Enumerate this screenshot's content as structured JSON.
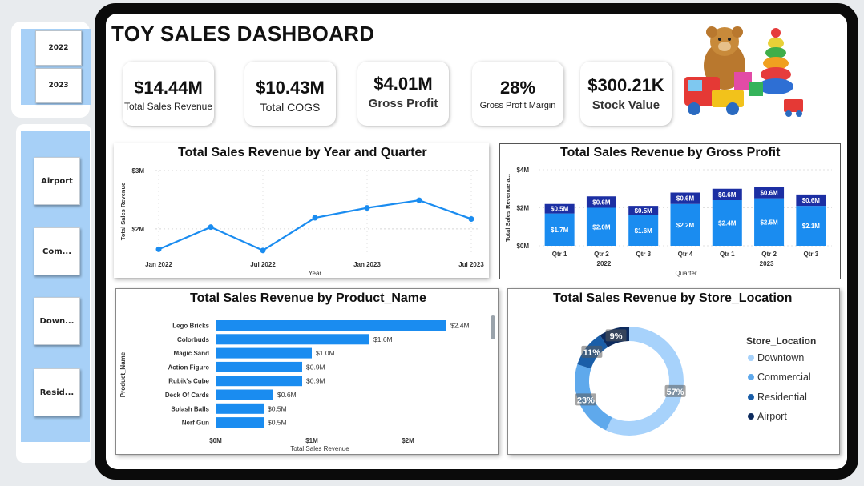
{
  "dashboard_title": "TOY SALES DASHBOARD",
  "year_slicer": [
    "2022",
    "2023"
  ],
  "location_slicer": [
    "Airport",
    "Com...",
    "Down...",
    "Resid..."
  ],
  "kpis": [
    {
      "value": "$14.44M",
      "label": "Total Sales Revenue"
    },
    {
      "value": "$10.43M",
      "label": "Total COGS"
    },
    {
      "value": "$4.01M",
      "label": "Gross Profit"
    },
    {
      "value": "28%",
      "label": "Gross Profit Margin"
    },
    {
      "value": "$300.21K",
      "label": "Stock Value"
    }
  ],
  "colors": {
    "line": "#1a8cf0",
    "bar_dark": "#1c2fa3",
    "bar_light": "#1a8cf0",
    "downtown": "#a7d2fb",
    "commercial": "#5fa9ec",
    "residential": "#1a5ea8",
    "airport": "#0d2b5e"
  },
  "chart_data": [
    {
      "type": "line",
      "title": "Total Sales Revenue by Year and Quarter",
      "xlabel": "Year",
      "ylabel": "Total Sales Revenue",
      "x_tick_labels": [
        "Jan 2022",
        "Jul 2022",
        "Jan 2023",
        "Jul 2023"
      ],
      "y_tick_labels": [
        "$3M",
        "$2M"
      ],
      "ylim": [
        1.6,
        3.0
      ],
      "grid": true,
      "x": [
        "2022 Q1",
        "2022 Q2",
        "2022 Q3",
        "2022 Q4",
        "2023 Q1",
        "2023 Q2",
        "2023 Q3"
      ],
      "series": [
        {
          "values": [
            1.65,
            2.03,
            1.63,
            2.19,
            2.36,
            2.49,
            2.17
          ]
        }
      ]
    },
    {
      "type": "bar",
      "stacked": true,
      "title": "Total Sales Revenue by Gross Profit",
      "xlabel": "Quarter",
      "ylabel": "Total Sales Revenue a...",
      "categories": [
        "Qtr 1",
        "Qtr 2",
        "Qtr 3",
        "Qtr 4",
        "Qtr 1",
        "Qtr 2",
        "Qtr 3"
      ],
      "year_groups": [
        "2022",
        "2023"
      ],
      "y_tick_labels": [
        "$4M",
        "$2M",
        "$0M"
      ],
      "ylim": [
        0,
        4
      ],
      "series": [
        {
          "values": [
            1.7,
            2.0,
            1.6,
            2.2,
            2.4,
            2.5,
            2.1
          ],
          "labels": [
            "$1.7M",
            "$2.0M",
            "$1.6M",
            "$2.2M",
            "$2.4M",
            "$2.5M",
            "$2.1M"
          ]
        },
        {
          "values": [
            0.5,
            0.6,
            0.5,
            0.6,
            0.6,
            0.6,
            0.6
          ],
          "labels": [
            "$0.5M",
            "$0.6M",
            "$0.5M",
            "$0.6M",
            "$0.6M",
            "$0.6M",
            "$0.6M"
          ]
        }
      ]
    },
    {
      "type": "bar",
      "orientation": "horizontal",
      "title": "Total Sales Revenue by Product_Name",
      "xlabel": "Total Sales Revenue",
      "ylabel": "Product_Name",
      "categories": [
        "Lego Bricks",
        "Colorbuds",
        "Magic Sand",
        "Action Figure",
        "Rubik's Cube",
        "Deck Of Cards",
        "Splash Balls",
        "Nerf Gun"
      ],
      "values": [
        2.4,
        1.6,
        1.0,
        0.9,
        0.9,
        0.6,
        0.5,
        0.5
      ],
      "value_labels": [
        "$2.4M",
        "$1.6M",
        "$1.0M",
        "$0.9M",
        "$0.9M",
        "$0.6M",
        "$0.5M",
        "$0.5M"
      ],
      "x_tick_labels": [
        "$0M",
        "$1M",
        "$2M"
      ],
      "xlim": [
        0,
        2.5
      ]
    },
    {
      "type": "pie",
      "donut": true,
      "title": "Total Sales Revenue by Store_Location",
      "legend_title": "Store_Location",
      "legend_position": "right",
      "labels": [
        "Downtown",
        "Commercial",
        "Residential",
        "Airport"
      ],
      "values": [
        57,
        23,
        11,
        9
      ],
      "value_labels": [
        "57%",
        "23%",
        "11%",
        "9%"
      ]
    }
  ]
}
